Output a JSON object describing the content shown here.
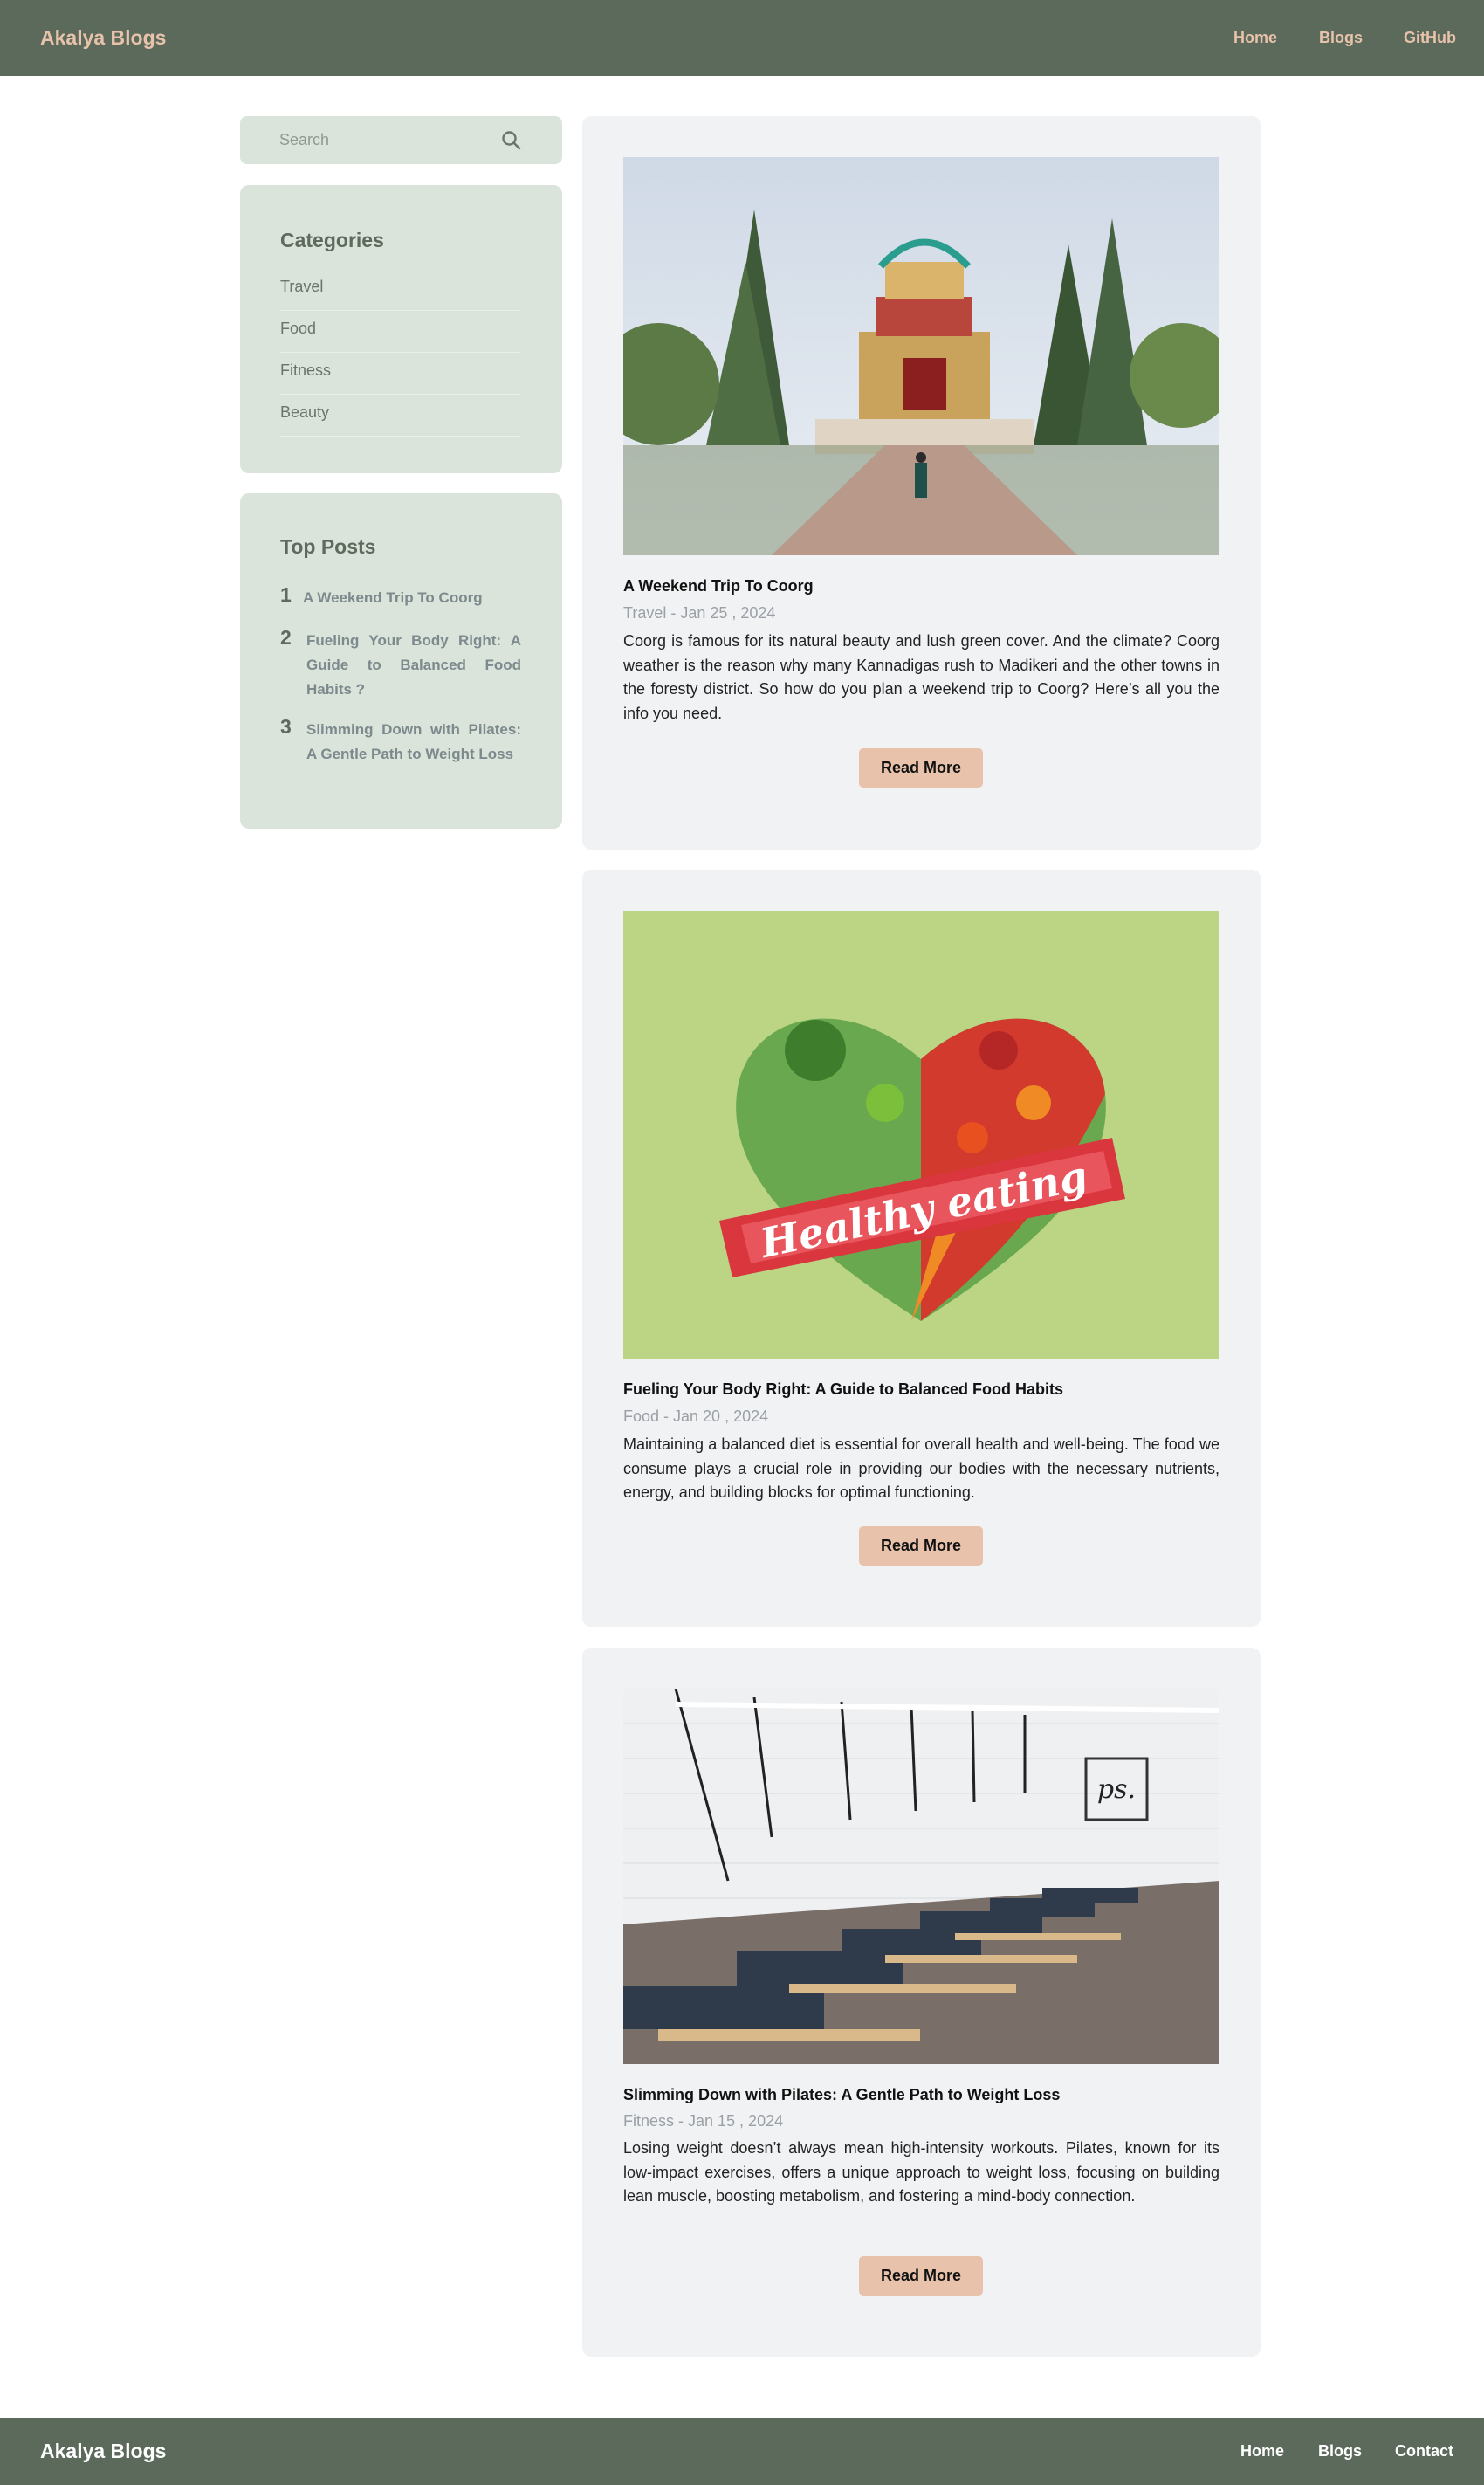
{
  "header": {
    "brand": "Akalya Blogs",
    "nav": [
      "Home",
      "Blogs",
      "GitHub"
    ]
  },
  "search": {
    "placeholder": "Search",
    "icon": "search-icon"
  },
  "categories": {
    "title": "Categories",
    "items": [
      "Travel",
      "Food",
      "Fitness",
      "Beauty"
    ]
  },
  "top_posts": {
    "title": "Top Posts",
    "items": [
      {
        "rank": "1",
        "title": "A Weekend Trip To Coorg"
      },
      {
        "rank": "2",
        "title": "Fueling Your Body Right: A Guide to Balanced Food Habits ?"
      },
      {
        "rank": "3",
        "title": "Slimming Down with Pilates: A Gentle Path to Weight Loss"
      }
    ]
  },
  "posts": [
    {
      "title": "A Weekend Trip To Coorg",
      "meta": "Travel - Jan 25 , 2024",
      "excerpt": "Coorg is famous for its natural beauty and lush green cover. And the climate? Coorg weather is the reason why many Kannadigas rush to Madikeri and the other towns in the foresty district. So how do you plan a weekend trip to Coorg? Here’s all you the info you need.",
      "button": "Read More"
    },
    {
      "title": "Fueling Your Body Right: A Guide to Balanced Food Habits",
      "meta": "Food - Jan 20 , 2024",
      "excerpt": "Maintaining a balanced diet is essential for overall health and well-being. The food we consume plays a crucial role in providing our bodies with the necessary nutrients, energy, and building blocks for optimal functioning.",
      "button": "Read More",
      "image_text": "Healthy eating"
    },
    {
      "title": "Slimming Down with Pilates: A Gentle Path to Weight Loss",
      "meta": "Fitness - Jan 15 , 2024",
      "excerpt": "Losing weight doesn’t always mean high-intensity workouts. Pilates, known for its low-impact exercises, offers a unique approach to weight loss, focusing on building lean muscle, boosting metabolism, and fostering a mind-body connection.",
      "button": "Read More",
      "image_text": "ps."
    }
  ],
  "footer": {
    "brand": "Akalya Blogs",
    "nav": [
      "Home",
      "Blogs",
      "Contact"
    ]
  },
  "colors": {
    "header_bg": "#5b6a5b",
    "accent": "#e8c2aa",
    "sidebar_bg": "#dbe4da",
    "card_bg": "#f1f2f4"
  }
}
